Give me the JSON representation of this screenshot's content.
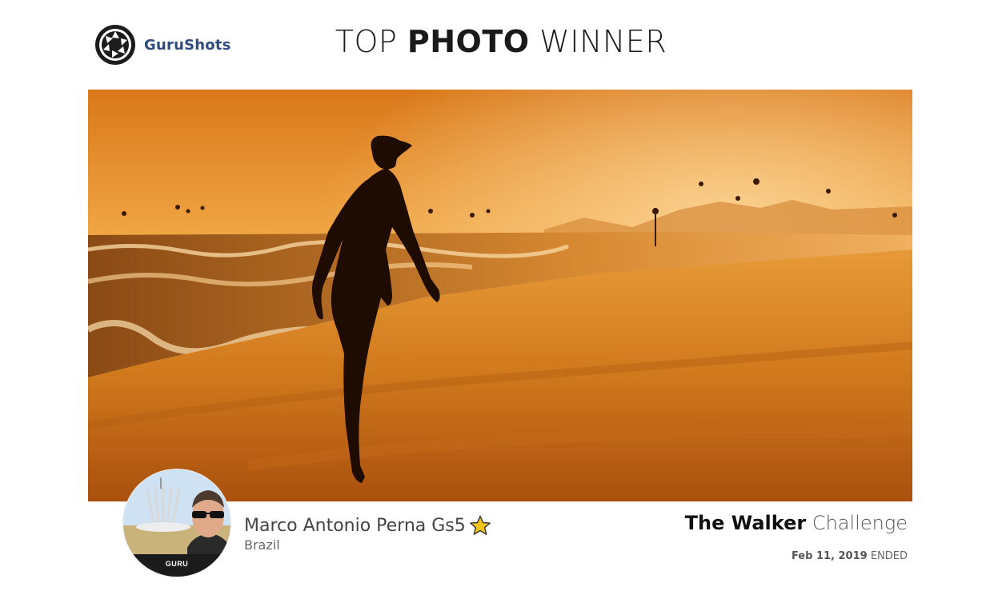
{
  "brand": {
    "name": "GuruShots"
  },
  "headline": {
    "part1": "TOP ",
    "part2": "PHOTO",
    "part3": " WINNER"
  },
  "photo": {
    "subject": "beach-sunset-walker-icon"
  },
  "winner": {
    "name": "Marco Antonio Perna Gs5",
    "country": "Brazil",
    "rank_badge": "GURU",
    "star_color": "#f5c518"
  },
  "challenge": {
    "title_bold": "The Walker",
    "title_light": " Challenge",
    "date": "Feb 11, 2019",
    "status": " ENDED"
  },
  "colors": {
    "brand_blue": "#2f4a7c",
    "photo_orange": "#e08a1c"
  }
}
